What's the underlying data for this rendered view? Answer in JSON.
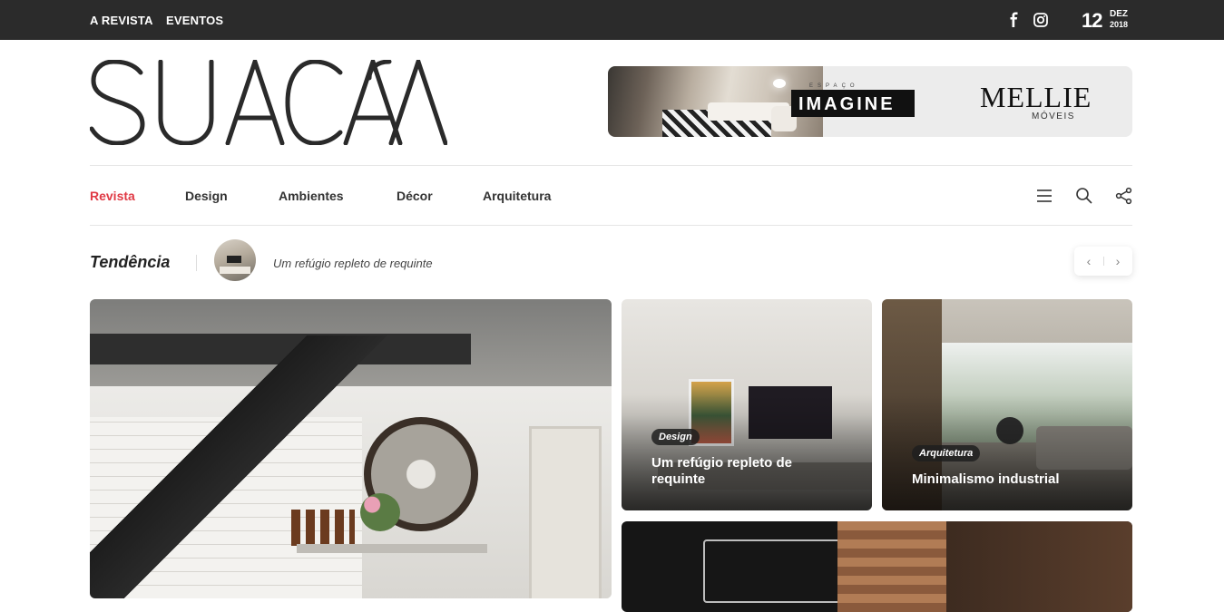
{
  "topbar": {
    "links": [
      "A REVISTA",
      "EVENTOS"
    ],
    "social": [
      "facebook-icon",
      "instagram-icon"
    ],
    "date": {
      "day": "12",
      "month": "DEZ",
      "year": "2018"
    },
    "background": "#2b2b2b"
  },
  "brand": {
    "logo_text": "SUACASA"
  },
  "ad": {
    "espaco": "ESPAÇO",
    "imagine": "IMAGINE",
    "mellie": "MELLIE",
    "moveis": "MÓVEIS"
  },
  "nav": {
    "items": [
      "Revista",
      "Design",
      "Ambientes",
      "Décor",
      "Arquitetura"
    ],
    "active_index": 0,
    "active_color": "#e03a45",
    "icons": [
      "menu-icon",
      "search-icon",
      "share-icon"
    ]
  },
  "trending": {
    "title": "Tendência",
    "headline": "Um refúgio repleto de requinte",
    "prev": "‹",
    "next": "›"
  },
  "cards": [
    {
      "tag": "Design",
      "title": "Um refúgio repleto de requinte"
    },
    {
      "tag": "Arquitetura",
      "title": "Minimalismo industrial"
    }
  ]
}
